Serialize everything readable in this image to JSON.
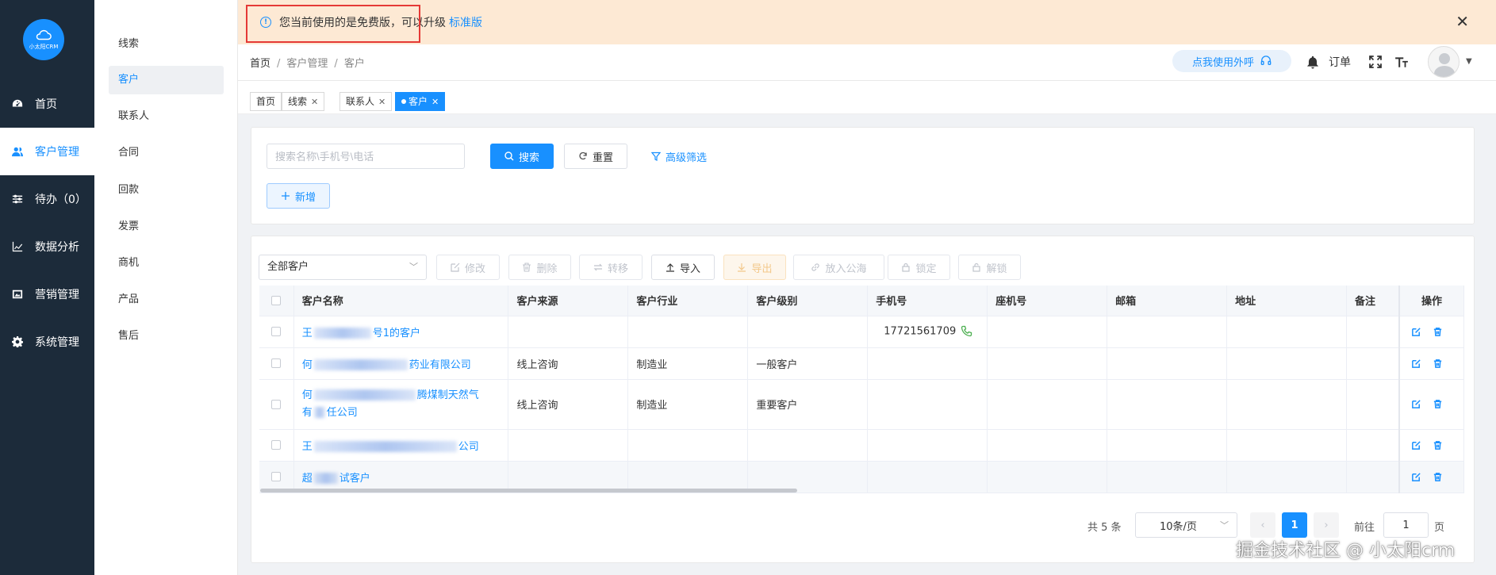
{
  "logo": {
    "text": "小太阳CRM"
  },
  "nav": [
    {
      "label": "首页",
      "icon": "dashboard-icon"
    },
    {
      "label": "客户管理",
      "icon": "users-icon",
      "active": true
    },
    {
      "label": "待办（0）",
      "icon": "sliders-icon"
    },
    {
      "label": "数据分析",
      "icon": "chart-icon"
    },
    {
      "label": "营销管理",
      "icon": "image-icon"
    },
    {
      "label": "系统管理",
      "icon": "gear-icon"
    }
  ],
  "submenu": [
    "线索",
    "客户",
    "联系人",
    "合同",
    "回款",
    "发票",
    "商机",
    "产品",
    "售后"
  ],
  "banner": {
    "text": "您当前使用的是免费版，可以升级",
    "link": "标准版"
  },
  "breadcrumb": [
    "首页",
    "客户管理",
    "客户"
  ],
  "header": {
    "call_button": "点我使用外呼",
    "order": "订单"
  },
  "tabs": [
    "首页",
    "线索",
    "联系人",
    "客户"
  ],
  "search": {
    "placeholder": "搜索名称\\手机号\\电话",
    "search_label": "搜索",
    "reset_label": "重置",
    "advanced_label": "高级筛选",
    "add_label": "新增"
  },
  "toolbar": {
    "filter_value": "全部客户",
    "edit": "修改",
    "delete": "删除",
    "transfer": "转移",
    "import": "导入",
    "export": "导出",
    "to_pool": "放入公海",
    "lock": "锁定",
    "unlock": "解锁"
  },
  "table": {
    "columns": [
      "客户名称",
      "客户来源",
      "客户行业",
      "客户级别",
      "手机号",
      "座机号",
      "邮箱",
      "地址",
      "备注",
      "操作"
    ],
    "rows": [
      {
        "name_a": "王",
        "name_b": "号1的客户",
        "source": "",
        "industry": "",
        "level": "",
        "mobile": "17721561709"
      },
      {
        "name_a": "何",
        "name_b": "药业有限公司",
        "source": "线上咨询",
        "industry": "制造业",
        "level": "一般客户",
        "mobile": ""
      },
      {
        "name_a": "何",
        "name_b": "腾煤制天然气",
        "name_c": "有",
        "name_d": "任公司",
        "source": "线上咨询",
        "industry": "制造业",
        "level": "重要客户",
        "mobile": ""
      },
      {
        "name_a": "王",
        "name_b": "公司",
        "source": "",
        "industry": "",
        "level": "",
        "mobile": ""
      },
      {
        "name_a": "超",
        "name_b": "试客户",
        "source": "",
        "industry": "",
        "level": "",
        "mobile": ""
      }
    ]
  },
  "pagination": {
    "total": "共 5 条",
    "page_size": "10条/页",
    "current": "1",
    "goto_prefix": "前往",
    "goto_value": "1",
    "goto_suffix": "页"
  },
  "watermark": "掘金技术社区 @ 小太阳crm",
  "colors": {
    "primary": "#1890ff",
    "sidebar": "#1c2b3a",
    "banner": "#fde9d4",
    "highlight_box": "#e53935"
  }
}
